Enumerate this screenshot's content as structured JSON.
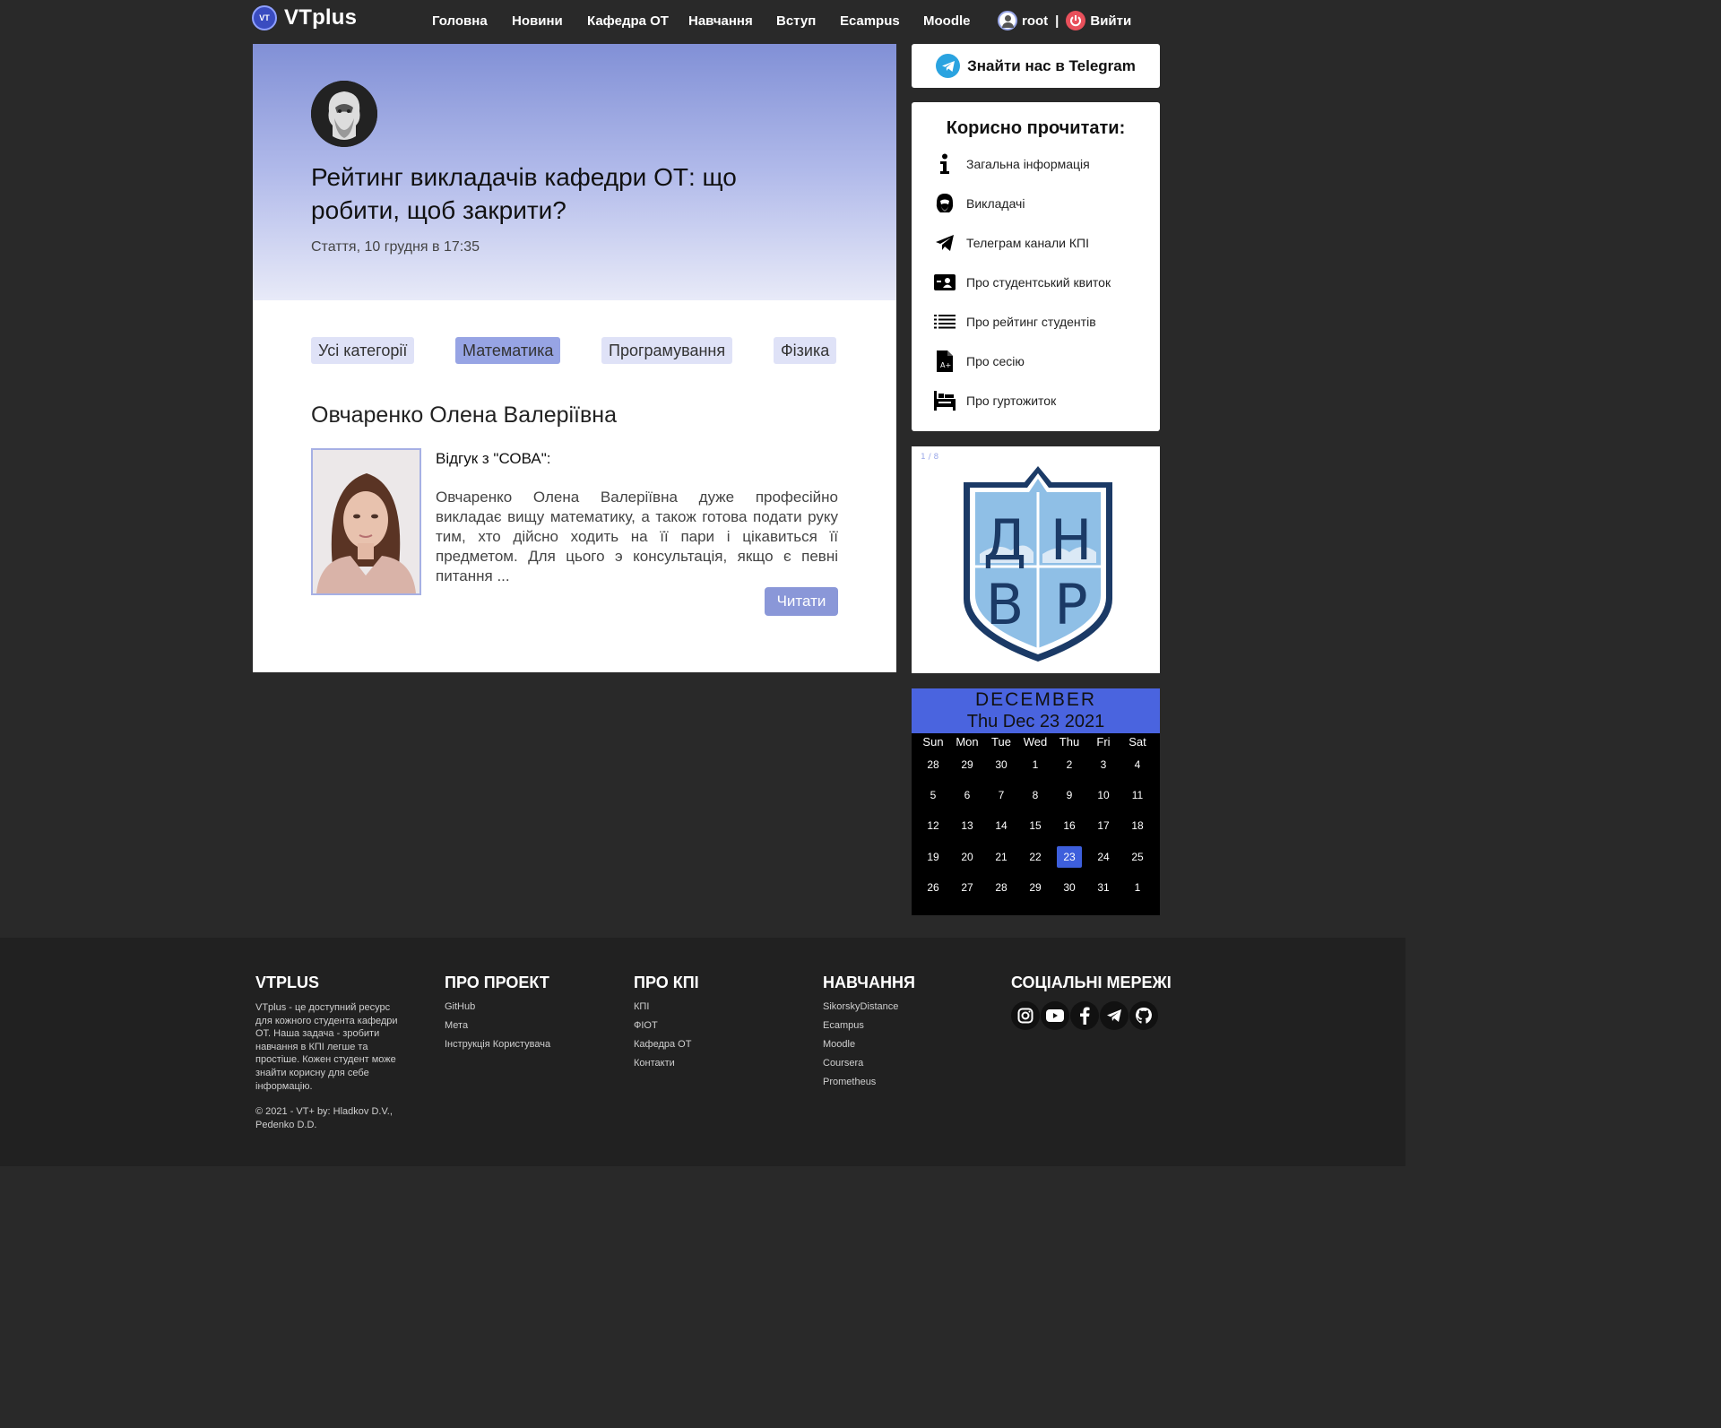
{
  "header": {
    "brand": "VTplus",
    "brand_badge": "VT",
    "nav": [
      "Головна",
      "Новини",
      "Кафедра ОТ",
      "Навчання",
      "Вступ",
      "Ecampus",
      "Moodle"
    ],
    "user": "root",
    "separator": "|",
    "logout": "Вийти"
  },
  "article": {
    "title": "Рейтинг викладачів кафедри ОТ: що робити, щоб закрити?",
    "meta": "Стаття, 10 грудня в 17:35",
    "categories": [
      "Усі категорії",
      "Математика",
      "Програмування",
      "Фізика"
    ],
    "active_category": "Математика",
    "teacher_name": "Овчаренко Олена Валеріївна",
    "review_head": "Відгук з \"СОВА\":",
    "review_text": "Овчаренко Олена Валеріївна дуже професійно викладає вищу математику, а також готова подати руку тим, хто дійсно ходить на її пари і цікавиться її предметом. Для цього э консультація, якщо є певні питання ...",
    "read_button": "Читати"
  },
  "sidebar": {
    "telegram_label": "Знайти нас в Telegram",
    "useful_title": "Корисно прочитати:",
    "useful_items": [
      {
        "label": "Загальна інформація",
        "icon": "info-icon"
      },
      {
        "label": "Викладачі",
        "icon": "teacher-icon"
      },
      {
        "label": "Телеграм канали КПІ",
        "icon": "paper-plane-icon"
      },
      {
        "label": "Про студентський квиток",
        "icon": "id-card-icon"
      },
      {
        "label": "Про рейтинг студентів",
        "icon": "list-icon"
      },
      {
        "label": "Про сесію",
        "icon": "grade-file-icon"
      },
      {
        "label": "Про гуртожиток",
        "icon": "dormitory-icon"
      }
    ],
    "slider_counter": "1 / 8",
    "slider_logo_letters": [
      "Д",
      "Н",
      "В",
      "Р"
    ]
  },
  "calendar": {
    "month": "DECEMBER",
    "full_date": "Thu Dec 23 2021",
    "weekdays": [
      "Sun",
      "Mon",
      "Tue",
      "Wed",
      "Thu",
      "Fri",
      "Sat"
    ],
    "weeks": [
      [
        "28",
        "29",
        "30",
        "1",
        "2",
        "3",
        "4"
      ],
      [
        "5",
        "6",
        "7",
        "8",
        "9",
        "10",
        "11"
      ],
      [
        "12",
        "13",
        "14",
        "15",
        "16",
        "17",
        "18"
      ],
      [
        "19",
        "20",
        "21",
        "22",
        "23",
        "24",
        "25"
      ],
      [
        "26",
        "27",
        "28",
        "29",
        "30",
        "31",
        "1"
      ]
    ],
    "today": "23"
  },
  "footer": {
    "about": {
      "title": "VTPLUS",
      "description": "VTplus - це доступний ресурс для кожного студента кафедри ОТ. Наша задача - зробити навчання в КПІ легше та простіше. Кожен студент може знайти корисну для себе інформацію.",
      "copyright": "© 2021 - VT+ by: Hladkov D.V., Pedenko D.D."
    },
    "project": {
      "title": "ПРО ПРОЕКТ",
      "links": [
        "GitHub",
        "Мета",
        "Інструкція Користувача"
      ]
    },
    "kpi": {
      "title": "ПРО КПІ",
      "links": [
        "КПІ",
        "ФІОТ",
        "Кафедра ОТ",
        "Контакти"
      ]
    },
    "study": {
      "title": "НАВЧАННЯ",
      "links": [
        "SikorskyDistance",
        "Ecampus",
        "Moodle",
        "Coursera",
        "Prometheus"
      ]
    },
    "social": {
      "title": "СОЦІАЛЬНІ МЕРЕЖІ",
      "icons": [
        "instagram-icon",
        "youtube-icon",
        "facebook-icon",
        "telegram-icon",
        "github-icon"
      ]
    }
  },
  "colors": {
    "background": "#292929",
    "accent": "#8a97d8",
    "calendar_header": "#4a64df",
    "footer": "#212121"
  }
}
